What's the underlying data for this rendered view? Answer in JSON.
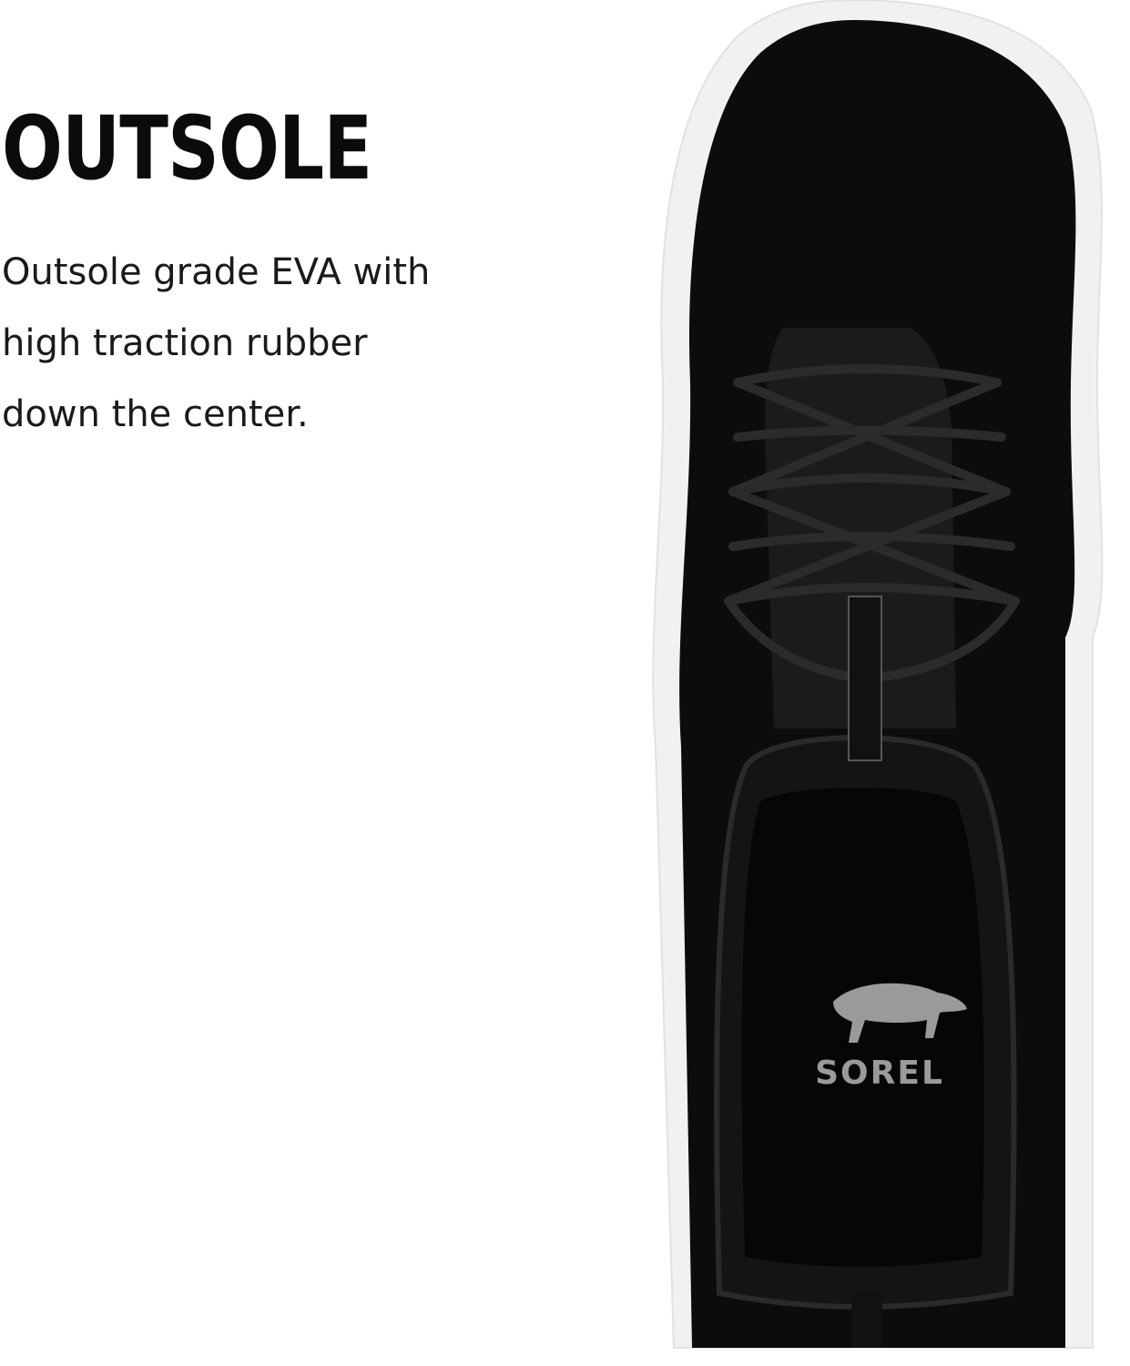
{
  "feature": {
    "heading": "OUTSOLE",
    "description_lines": [
      "Outsole grade EVA with",
      "high traction rubber",
      "down the center."
    ]
  },
  "product_image": {
    "subject": "black suede high-top sneaker with white sole, viewed from above",
    "logo_text": "SOREL",
    "colors": {
      "upper": "#0c0c0c",
      "sole": "#f2f2f2",
      "logo": "#9a9a9a"
    }
  }
}
